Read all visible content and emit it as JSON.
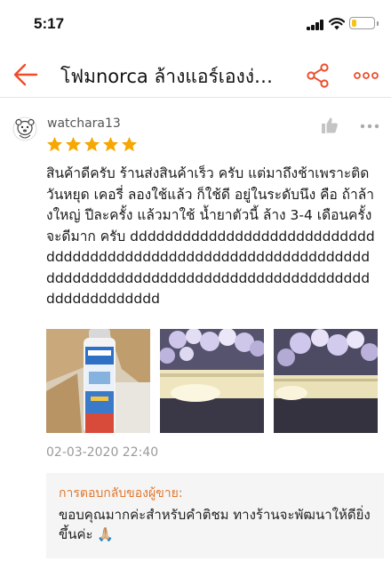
{
  "status_bar": {
    "time": "5:17",
    "battery_level": 0.25,
    "battery_color": "#f7c21a"
  },
  "header": {
    "title": "โฟมnorca ล้างแอร์เองง่…",
    "back_icon": "back-arrow-icon",
    "share_icon": "share-icon",
    "more_icon": "more-dots-icon",
    "accent_color": "#ee4d2d"
  },
  "review": {
    "username": "watchara13",
    "rating": 5,
    "rating_max": 5,
    "star_color": "#f6a700",
    "text": "สินค้าดีครับ ร้านส่งสินค้าเร็ว ครับ แต่มาถึงช้าเพราะติดวันหยุด เคอรี่  ลองใช้แล้ว ก็ใช้ดี อยู่ในระดับนึง คือ ถ้าล้างใหญ่ ปีละครั้ง แล้วมาใช้ น้ำยาตัวนี้ ล้าง 3-4 เดือนครั้ง จะดีมาก ครับ ddddddddddddddddddddddddddddddddddddddddddddddddddddddddddddddddddddddddddddddddddddddddddddddddddddddddddddddddddd",
    "photos": [
      "photo-spray-can",
      "photo-foam-on-coil",
      "photo-foam-on-unit"
    ],
    "date": "02-03-2020 22:40"
  },
  "seller_reply": {
    "label": "การตอบกลับของผู้ขาย:",
    "text": "ขอบคุณมากค่ะสำหรับคำติชม ทางร้านจะพัฒนาให้ดียิ่งขึ้นค่ะ 🙏🏼",
    "label_color": "#e0782d"
  }
}
